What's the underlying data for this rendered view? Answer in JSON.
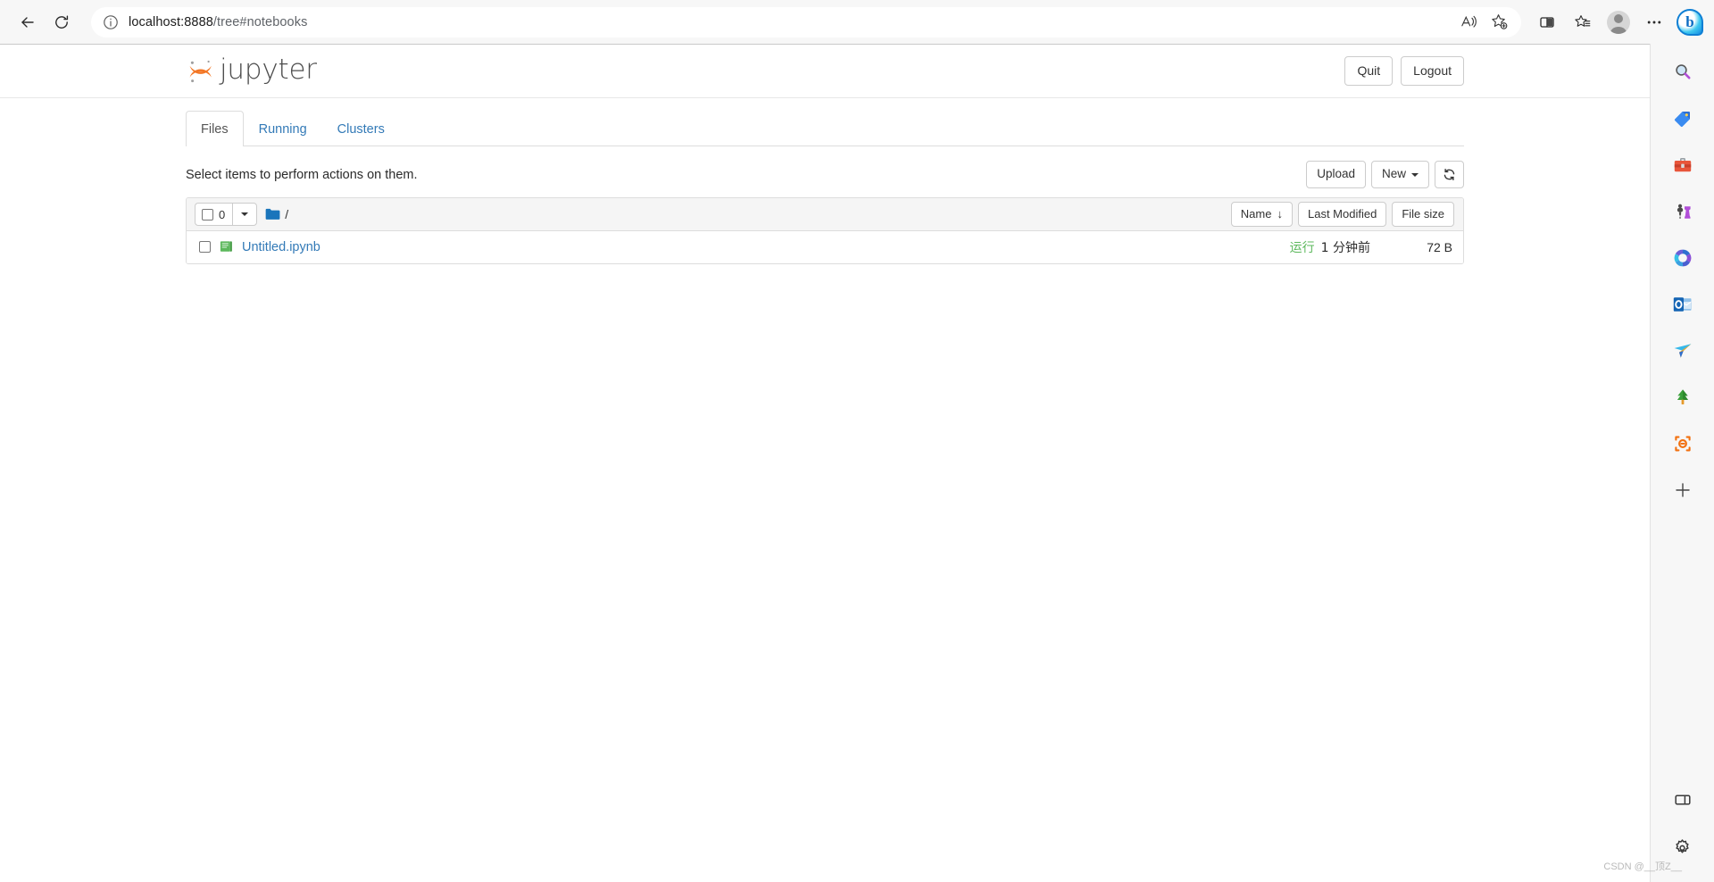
{
  "browser": {
    "back_label": "Back",
    "refresh_label": "Refresh",
    "site_info_label": "View site information",
    "url_host": "localhost:8888",
    "url_path": "/tree#notebooks",
    "read_aloud_label": "Read aloud",
    "add_favorite_label": "Add this page to favorites",
    "split_screen_label": "Split screen",
    "favorites_label": "Favorites",
    "profile_label": "Profile",
    "settings_more_label": "Settings and more",
    "copilot_label": "Bing Chat",
    "copilot_glyph": "b"
  },
  "sidebar": {
    "items": [
      {
        "name": "search-icon",
        "label": "Search"
      },
      {
        "name": "shopping-tag-icon",
        "label": "Shopping"
      },
      {
        "name": "tools-briefcase-icon",
        "label": "Tools"
      },
      {
        "name": "games-chess-icon",
        "label": "Games"
      },
      {
        "name": "microsoft-365-icon",
        "label": "Microsoft 365"
      },
      {
        "name": "outlook-icon",
        "label": "Outlook"
      },
      {
        "name": "paper-plane-icon",
        "label": "Send"
      },
      {
        "name": "tree-icon",
        "label": "Tree"
      },
      {
        "name": "drop-link-icon",
        "label": "Drop"
      }
    ],
    "add_label": "Add",
    "customize_pane_label": "Customize sidebar pane",
    "settings_label": "Settings"
  },
  "jupyter": {
    "logo_text": "jupyter",
    "quit_label": "Quit",
    "logout_label": "Logout",
    "tabs": [
      {
        "label": "Files",
        "active": true
      },
      {
        "label": "Running",
        "active": false
      },
      {
        "label": "Clusters",
        "active": false
      }
    ],
    "action_text": "Select items to perform actions on them.",
    "upload_label": "Upload",
    "new_label": "New",
    "refresh_label": "Refresh notebook list",
    "selected_count": "0",
    "breadcrumb_root": "/",
    "sort": {
      "name_label": "Name",
      "name_arrow": "↓",
      "last_modified_label": "Last Modified",
      "file_size_label": "File size"
    },
    "files": [
      {
        "name": "Untitled.ipynb",
        "icon": "notebook-icon",
        "status": "运行",
        "modified": "1 分钟前",
        "size": "72 B"
      }
    ]
  },
  "watermark": {
    "text": "CSDN @__顶Z__"
  }
}
